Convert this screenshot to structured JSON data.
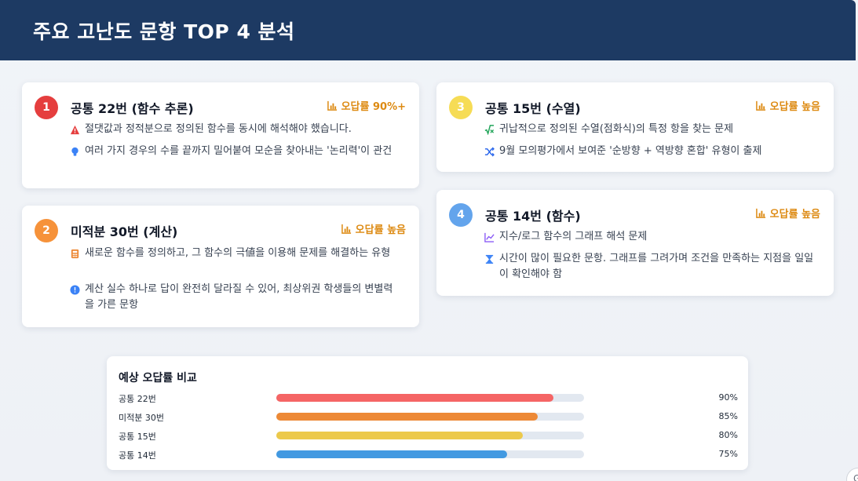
{
  "header": {
    "title": "주요 고난도 문항 TOP 4 분석"
  },
  "cards": [
    {
      "number": "1",
      "title": "공통 22번 (함수 추론)",
      "rate": "오답률 90%+",
      "lines": [
        {
          "icon": "warning-icon",
          "text": "절댓값과 정적분으로 정의된 함수를 동시에 해석해야 했습니다."
        },
        {
          "icon": "lightbulb-icon",
          "text": "여러 가지 경우의 수를 끝까지 밀어붙여 모순을 찾아내는 '논리력'이 관건"
        }
      ]
    },
    {
      "number": "2",
      "title": "미적분 30번 (계산)",
      "rate": "오답률 높음",
      "lines": [
        {
          "icon": "calculator-icon",
          "text": "새로운 함수를 정의하고, 그 함수의 극値을 이용해 문제를 해결하는 유형"
        },
        {
          "icon": "alert-circle-icon",
          "text": "계산 실수 하나로 답이 완전히 달라질 수 있어, 최상위권 학생들의 변별력을 가른 문항"
        }
      ]
    },
    {
      "number": "3",
      "title": "공통 15번 (수열)",
      "rate": "오답률 높음",
      "lines": [
        {
          "icon": "square-root-icon",
          "text": "귀납적으로 정의된 수열(점화식)의 특정 항을 찾는 문제"
        },
        {
          "icon": "shuffle-icon",
          "text": "9월 모의평가에서 보여준 '순방향 + 역방향 혼합' 유형이 출제"
        }
      ]
    },
    {
      "number": "4",
      "title": "공통 14번 (함수)",
      "rate": "오답률 높음",
      "lines": [
        {
          "icon": "line-chart-icon",
          "text": "지수/로그 함수의 그래프 해석 문제"
        },
        {
          "icon": "hourglass-icon",
          "text": "시간이 많이 필요한 문항. 그래프를 그려가며 조건을 만족하는 지점을 일일이 확인해야 함"
        }
      ]
    }
  ],
  "comparison": {
    "title": "예상 오답률 비교",
    "rows": [
      {
        "label": "공통 22번",
        "value": 90,
        "display": "90%",
        "color": "#f56565"
      },
      {
        "label": "미적분 30번",
        "value": 85,
        "display": "85%",
        "color": "#ed8936"
      },
      {
        "label": "공통 15번",
        "value": 80,
        "display": "80%",
        "color": "#ecc94b"
      },
      {
        "label": "공통 14번",
        "value": 75,
        "display": "75%",
        "color": "#4299e1"
      }
    ]
  },
  "colors": {
    "header": "#1d3a63",
    "rate": "#dd8a12",
    "badges": [
      "#e53e3e",
      "#f6923a",
      "#f6dc55",
      "#63a4ec"
    ]
  }
}
